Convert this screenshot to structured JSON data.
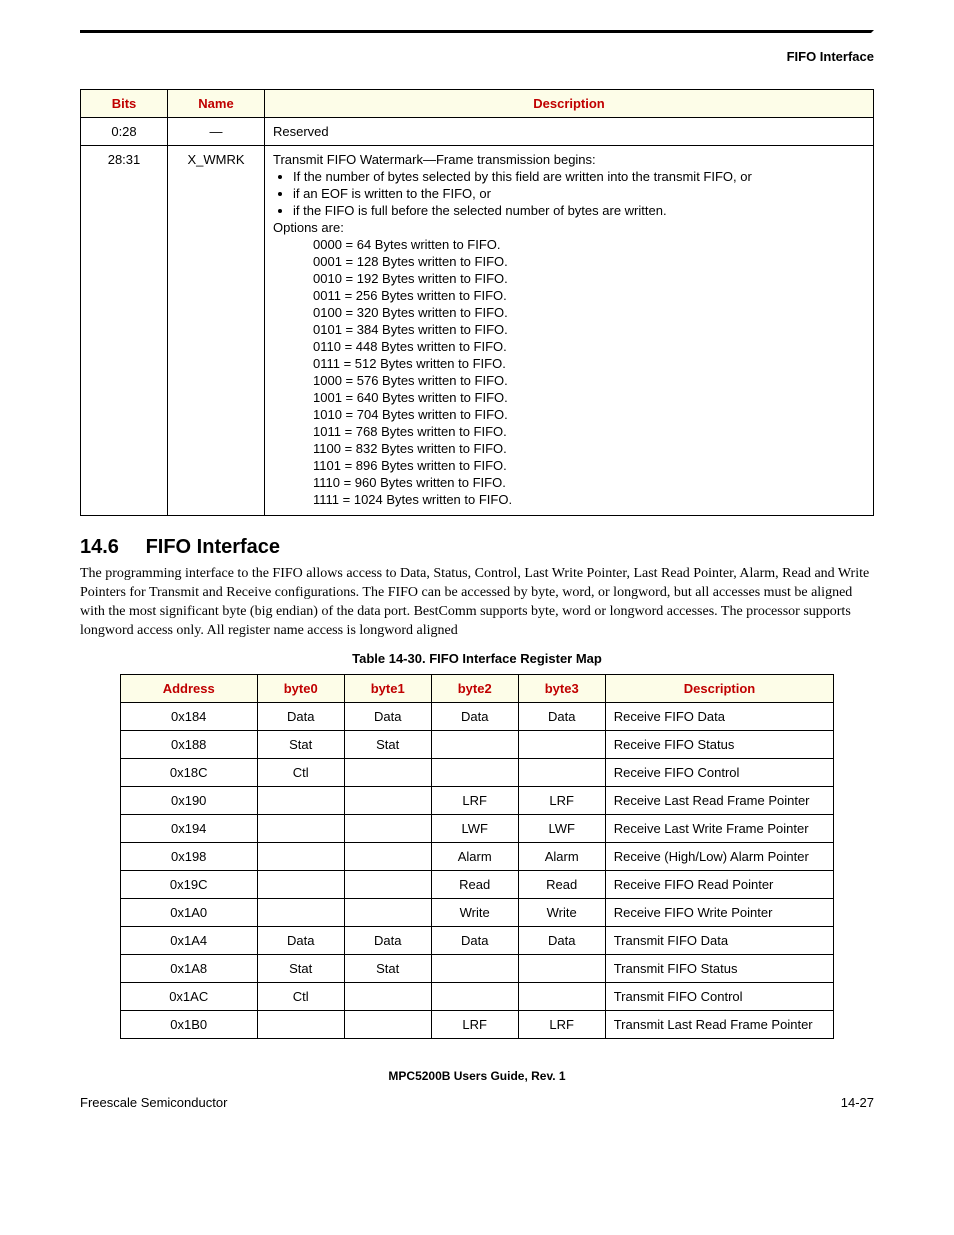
{
  "header": {
    "section_label": "FIFO Interface"
  },
  "table1": {
    "headers": {
      "bits": "Bits",
      "name": "Name",
      "desc": "Description"
    },
    "rows": [
      {
        "bits": "0:28",
        "name": "—",
        "desc_plain": "Reserved"
      },
      {
        "bits": "28:31",
        "name": "X_WMRK",
        "intro": "Transmit FIFO Watermark—Frame transmission begins:",
        "bullets": [
          "If the number of bytes selected by this field are written into the transmit FIFO, or",
          "if an EOF is written to the FIFO, or",
          "if the FIFO is full before the selected number of bytes are written."
        ],
        "options_label": "Options are:",
        "codes": [
          "0000 =   64 Bytes written to FIFO.",
          "0001 = 128 Bytes written to FIFO.",
          "0010 = 192 Bytes written to FIFO.",
          "0011 = 256 Bytes written to FIFO.",
          "0100 = 320 Bytes written to FIFO.",
          "0101 = 384 Bytes written to FIFO.",
          "0110 = 448 Bytes written to FIFO.",
          "0111 = 512 Bytes written to FIFO.",
          "1000 = 576 Bytes written to FIFO.",
          "1001 = 640 Bytes written to FIFO.",
          "1010 = 704 Bytes written to FIFO.",
          "1011 = 768 Bytes written to FIFO.",
          "1100 = 832 Bytes written to FIFO.",
          "1101 = 896 Bytes written to FIFO.",
          "1110 = 960 Bytes written to FIFO.",
          "1111 = 1024 Bytes written to FIFO."
        ]
      }
    ]
  },
  "section": {
    "number": "14.6",
    "title": "FIFO Interface",
    "body": "The programming interface to the FIFO allows access to Data, Status, Control, Last Write Pointer, Last Read Pointer, Alarm, Read and Write Pointers for Transmit and Receive configurations. The FIFO can be accessed by byte, word, or longword, but all accesses must be aligned with the most significant byte (big endian) of the data port. BestComm supports byte, word or longword accesses. The processor supports longword access only. All register name access is longword aligned"
  },
  "table2": {
    "caption": "Table 14-30. FIFO Interface Register Map",
    "headers": {
      "addr": "Address",
      "b0": "byte0",
      "b1": "byte1",
      "b2": "byte2",
      "b3": "byte3",
      "desc": "Description"
    },
    "rows": [
      {
        "addr": "0x184",
        "b0": "Data",
        "b1": "Data",
        "b2": "Data",
        "b3": "Data",
        "desc": "Receive FIFO Data"
      },
      {
        "addr": "0x188",
        "b0": "Stat",
        "b1": "Stat",
        "b2": "",
        "b3": "",
        "desc": "Receive FIFO Status"
      },
      {
        "addr": "0x18C",
        "b0": "Ctl",
        "b1": "",
        "b2": "",
        "b3": "",
        "desc": "Receive FIFO Control"
      },
      {
        "addr": "0x190",
        "b0": "",
        "b1": "",
        "b2": "LRF",
        "b3": "LRF",
        "desc": "Receive Last Read Frame Pointer"
      },
      {
        "addr": "0x194",
        "b0": "",
        "b1": "",
        "b2": "LWF",
        "b3": "LWF",
        "desc": "Receive Last Write Frame Pointer"
      },
      {
        "addr": "0x198",
        "b0": "",
        "b1": "",
        "b2": "Alarm",
        "b3": "Alarm",
        "desc": "Receive (High/Low) Alarm Pointer"
      },
      {
        "addr": "0x19C",
        "b0": "",
        "b1": "",
        "b2": "Read",
        "b3": "Read",
        "desc": "Receive FIFO Read Pointer"
      },
      {
        "addr": "0x1A0",
        "b0": "",
        "b1": "",
        "b2": "Write",
        "b3": "Write",
        "desc": "Receive FIFO Write Pointer"
      },
      {
        "addr": "0x1A4",
        "b0": "Data",
        "b1": "Data",
        "b2": "Data",
        "b3": "Data",
        "desc": "Transmit FIFO Data"
      },
      {
        "addr": "0x1A8",
        "b0": "Stat",
        "b1": "Stat",
        "b2": "",
        "b3": "",
        "desc": "Transmit FIFO Status"
      },
      {
        "addr": "0x1AC",
        "b0": "Ctl",
        "b1": "",
        "b2": "",
        "b3": "",
        "desc": "Transmit FIFO Control"
      },
      {
        "addr": "0x1B0",
        "b0": "",
        "b1": "",
        "b2": "LRF",
        "b3": "LRF",
        "desc": "Transmit Last Read Frame Pointer"
      }
    ]
  },
  "footer": {
    "doc_title": "MPC5200B Users Guide, Rev. 1",
    "left": "Freescale Semiconductor",
    "right": "14-27"
  }
}
